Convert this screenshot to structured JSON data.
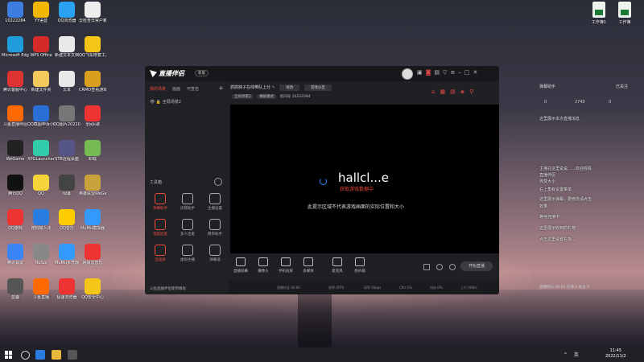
{
  "desktop": {
    "icons": [
      {
        "label": "10222284",
        "color": "#3e7de0"
      },
      {
        "label": "YY语音",
        "color": "#f2b705"
      },
      {
        "label": "QQ浏览器",
        "color": "#2aa0f0"
      },
      {
        "label": "云检查日常户籍",
        "color": "#eeeeee"
      },
      {
        "label": "Microsoft Edge",
        "color": "#1f9cdb"
      },
      {
        "label": "WPS Office",
        "color": "#d42a2a"
      },
      {
        "label": "新建文本文档",
        "color": "#e8e8e8"
      },
      {
        "label": "QQ飞车修复工具",
        "color": "#f5c518"
      },
      {
        "label": "腾讯客服中心",
        "color": "#d33"
      },
      {
        "label": "新建文件夹",
        "color": "#f3c95b"
      },
      {
        "label": "文本",
        "color": "#e8e8e8"
      },
      {
        "label": "CRMO查看游戏助手",
        "color": "#d9a020"
      },
      {
        "label": "斗鱼直播伴侣",
        "color": "#ff6a00"
      },
      {
        "label": "QQ截图申诉小程序",
        "color": "#2a6fd6"
      },
      {
        "label": "QQ图片20220316...",
        "color": "#777"
      },
      {
        "label": "全民k歌",
        "color": "#e33"
      },
      {
        "label": "WeGame",
        "color": "#222"
      },
      {
        "label": "XPGLauncher",
        "color": "#3ca"
      },
      {
        "label": "STB远程桌面",
        "color": "#558"
      },
      {
        "label": "卸载",
        "color": "#7b5"
      },
      {
        "label": "腾讯QQ",
        "color": "#111"
      },
      {
        "label": "QQ",
        "color": "#f5d33b"
      },
      {
        "label": "绿幕",
        "color": "#444"
      },
      {
        "label": "英雄联盟WeGame版",
        "color": "#c9a23c"
      },
      {
        "label": "QQ游戏",
        "color": "#e33"
      },
      {
        "label": "搜狗输入法",
        "color": "#2a7de0"
      },
      {
        "label": "QQ音乐",
        "color": "#ffcc00"
      },
      {
        "label": "MuMu模拟器",
        "color": "#3399ff"
      },
      {
        "label": "腾讯会议",
        "color": "#3b86f7"
      },
      {
        "label": "Rufus",
        "color": "#888"
      },
      {
        "label": "MuMu多开器",
        "color": "#3399ff"
      },
      {
        "label": "网易云音乐",
        "color": "#e33"
      },
      {
        "label": "蓝叠",
        "color": "#555"
      },
      {
        "label": "斗鱼直播",
        "color": "#ff6a00"
      },
      {
        "label": "极速浏览器",
        "color": "#e33"
      },
      {
        "label": "QQ安全中心",
        "color": "#f5c518"
      }
    ],
    "right_files": [
      {
        "label": "工作簿1"
      },
      {
        "label": "工作簿"
      }
    ]
  },
  "right_panel": {
    "title": "弹幕助手",
    "closed": "已关注",
    "stats": [
      "0",
      "2740",
      "0"
    ],
    "lines": [
      "这里展示本次直播消息",
      "主播在这里说说……欢迎观看",
      "直播伴侣",
      "改变大小",
      "右上角有设置菜单",
      "这里展示弹幕，要修改请点击",
      "效果",
      "等待连接中",
      "这里展示收到的礼物",
      "点击这里设置礼物..."
    ],
    "footer": "直播时长 00:00  在线 0  关注 0"
  },
  "app": {
    "logo": "直播伴侣",
    "version": "新版",
    "left_tabs": [
      {
        "label": "我的场景",
        "active": true
      },
      {
        "label": "画面",
        "active": false
      },
      {
        "label": "可签名",
        "active": false
      }
    ],
    "scene": "全局场景2",
    "tools_label": "工具箱",
    "tools": [
      {
        "label": "弹幕助手",
        "red": true
      },
      {
        "label": "房管助手",
        "red": false
      },
      {
        "label": "主播设置",
        "red": false
      },
      {
        "label": "电脑连麦",
        "red": true
      },
      {
        "label": "多人连麦",
        "red": false
      },
      {
        "label": "携带助手",
        "red": false
      },
      {
        "label": "连送屏",
        "red": true
      },
      {
        "label": "虚拟主播",
        "red": false
      },
      {
        "label": "弹幕墙",
        "red": false
      }
    ],
    "left_footer": "斗鱼直播伴侣使用教程",
    "room_title": "抓抓妹子在线带队上分",
    "room_tag1": "修改",
    "room_tag2": "游戏分区",
    "sub_pill": "全局场景2",
    "sub_mode": "横屏模式",
    "sub_text": "房间号 10222284",
    "preview_title": "hallcl...e",
    "preview_sub": "获取游戏数据中",
    "preview_note": "此提示区域不代表游戏画面的实际位置和大小",
    "bottom_tools": [
      {
        "label": "直播屏幕"
      },
      {
        "label": "摄像头"
      },
      {
        "label": "手机投屏"
      },
      {
        "label": "多媒体"
      },
      {
        "label": "麦克风"
      },
      {
        "label": "扬声器"
      }
    ],
    "start_label": "开始直播",
    "status": [
      "直播时长 00:00",
      "帧率 0FPS",
      "码率 0kbps",
      "CPU 0%",
      "内存 0%",
      "上行 0KB/s"
    ]
  },
  "taskbar": {
    "tray": "^ 英",
    "time": "11:45",
    "date": "2022/11/2"
  }
}
